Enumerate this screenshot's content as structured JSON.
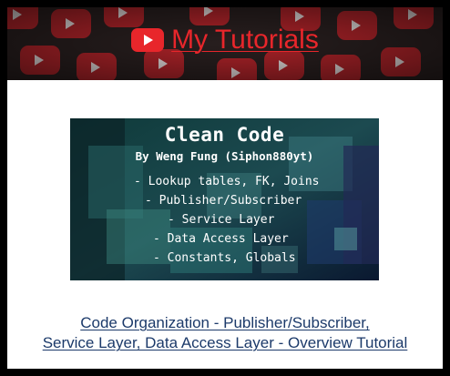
{
  "header": {
    "title": "My Tutorials",
    "logo_icon": "youtube-play-icon",
    "background_pattern_icon": "youtube-play-icon",
    "title_color": "#e8262b"
  },
  "video": {
    "thumbnail": {
      "title": "Clean Code",
      "subtitle": "By Weng Fung (Siphon880yt)",
      "lines": [
        "- Lookup tables, FK, Joins",
        "- Publisher/Subscriber",
        "- Service Layer",
        "- Data Access Layer",
        "- Constants, Globals"
      ]
    },
    "caption_lines": [
      "Code Organization - Publisher/Subscriber,",
      "Service Layer, Data Access Layer - Overview Tutorial"
    ],
    "link_color": "#1c3a6a"
  }
}
